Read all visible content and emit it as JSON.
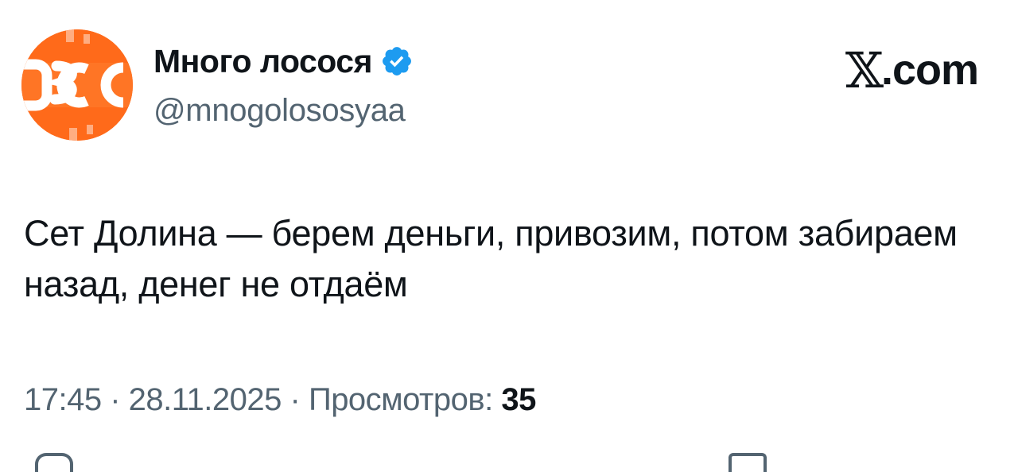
{
  "author": {
    "display_name": "Много лосося",
    "handle": "@mnogolososyaa",
    "verified": true,
    "avatar_text": "OCO",
    "avatar_color": "#ff6a1a"
  },
  "platform": {
    "logo_glyph": "𝕏",
    "logo_suffix": ".com"
  },
  "tweet": {
    "text": "Сет Долина — берем деньги, привозим, потом забираем назад, денег не отдаём"
  },
  "meta": {
    "time": "17:45",
    "separator1": " · ",
    "date": "28.11.2025",
    "separator2": " · ",
    "views_label": "Просмотров: ",
    "views_count": "35"
  },
  "colors": {
    "text_primary": "#0f1419",
    "text_secondary": "#536471",
    "verified_blue": "#1d9bf0"
  }
}
